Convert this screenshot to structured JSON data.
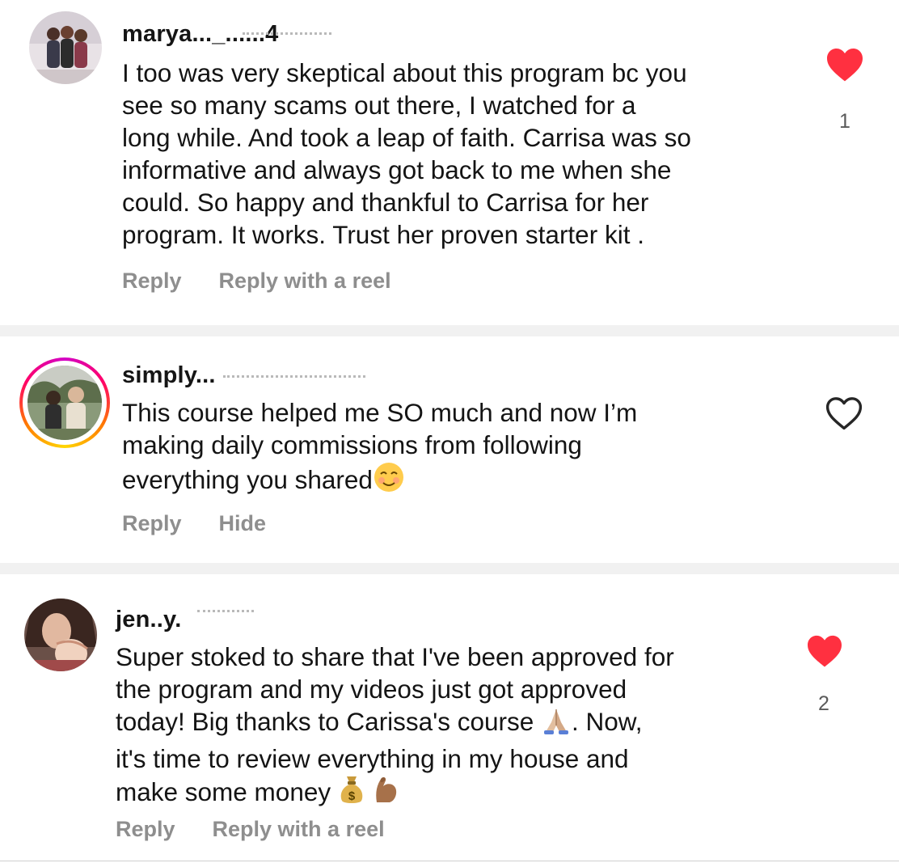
{
  "comments": [
    {
      "username": "marya..._......4",
      "text": "I too was very skeptical about this program bc you\nsee so many scams out there,  I watched for a\nlong while. And took a leap of faith. Carrisa was so\ninformative and always got back to me when she\ncould.  So happy and thankful to Carrisa for her\nprogram.  It works. Trust her proven starter kit .",
      "actions": [
        "Reply",
        "Reply with a reel"
      ],
      "liked": true,
      "like_count": "1"
    },
    {
      "username": "simply...",
      "text": "This course helped me SO much and now I’m\nmaking daily commissions from following\neverything you shared",
      "actions": [
        "Reply",
        "Hide"
      ],
      "liked": false,
      "like_count": ""
    },
    {
      "username": "jen..y.",
      "text_lines": [
        "Super stoked to share that I've been approved for",
        "the program and my videos just got approved",
        "today! Big thanks to Carissa's course ",
        "it's time to review everything in my house and",
        "make some money "
      ],
      "line3_tail": ". Now,",
      "actions": [
        "Reply",
        "Reply with a reel"
      ],
      "liked": true,
      "like_count": "2"
    }
  ],
  "icons": {
    "liked_heart": "heart-filled-icon",
    "unliked_heart": "heart-outline-icon",
    "emoji_smile": "smiling-face-icon",
    "emoji_pray": "folded-hands-icon",
    "emoji_money": "money-bag-icon",
    "emoji_muscle": "flexed-biceps-icon"
  },
  "colors": {
    "heart_red": "#ff3040",
    "action_gray": "#8e8e8e",
    "separator": "#f1f1f1"
  }
}
